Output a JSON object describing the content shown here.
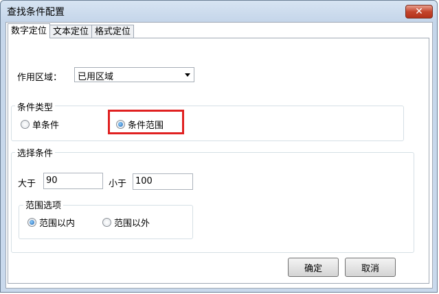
{
  "window": {
    "title": "查找条件配置",
    "close_glyph": "✕"
  },
  "tabs": [
    {
      "label": "数字定位",
      "active": true
    },
    {
      "label": "文本定位",
      "active": false
    },
    {
      "label": "格式定位",
      "active": false
    }
  ],
  "scope": {
    "label": "作用区域：",
    "value": "已用区域"
  },
  "condition_type": {
    "title": "条件类型",
    "options": [
      {
        "label": "单条件",
        "checked": false
      },
      {
        "label": "条件范围",
        "checked": true
      }
    ]
  },
  "select_condition": {
    "title": "选择条件",
    "greater_label": "大于",
    "greater_value": "90",
    "less_label": "小于",
    "less_value": "100",
    "range_options": {
      "title": "范围选项",
      "options": [
        {
          "label": "范围以内",
          "checked": true
        },
        {
          "label": "范围以外",
          "checked": false
        }
      ]
    }
  },
  "buttons": {
    "ok": "确定",
    "cancel": "取消"
  },
  "colors": {
    "highlight": "#e02020",
    "close_button": "#c4452c"
  }
}
